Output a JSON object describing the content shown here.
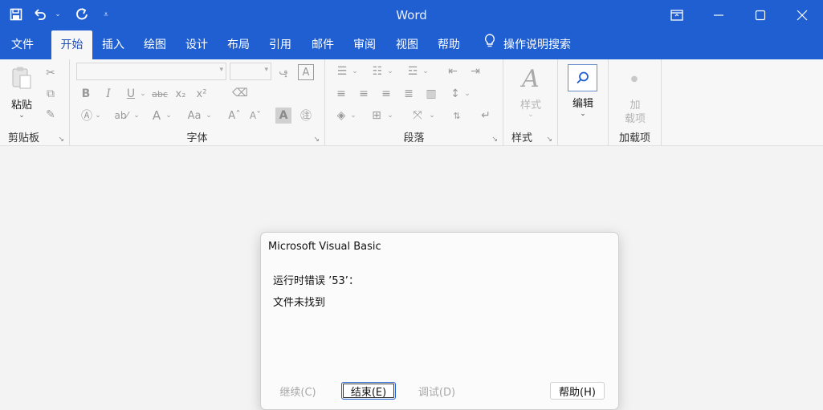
{
  "window": {
    "title": "Word"
  },
  "qat": {
    "save_icon": "save-icon",
    "undo_icon": "undo-icon",
    "redo_icon": "redo-icon",
    "customize_icon": "customize-icon"
  },
  "tabs": [
    {
      "label": "文件"
    },
    {
      "label": "开始"
    },
    {
      "label": "插入"
    },
    {
      "label": "绘图"
    },
    {
      "label": "设计"
    },
    {
      "label": "布局"
    },
    {
      "label": "引用"
    },
    {
      "label": "邮件"
    },
    {
      "label": "审阅"
    },
    {
      "label": "视图"
    },
    {
      "label": "帮助"
    }
  ],
  "tell_me": {
    "label": "操作说明搜索"
  },
  "ribbon": {
    "clipboard": {
      "label": "剪贴板",
      "paste_label": "粘贴"
    },
    "font": {
      "label": "字体",
      "font_name": "",
      "font_size": ""
    },
    "paragraph": {
      "label": "段落"
    },
    "styles": {
      "label": "样式",
      "button_label": "样式"
    },
    "editing": {
      "button_label": "编辑"
    },
    "addins": {
      "label": "加载项",
      "button_label_1": "加",
      "button_label_2": "载项"
    }
  },
  "dialog": {
    "title": "Microsoft Visual Basic",
    "message1": "运行时错误 ’53’：",
    "message2": "文件未找到",
    "buttons": {
      "continue": "继续(C)",
      "end": "结束(E)",
      "debug": "调试(D)",
      "help": "帮助(H)"
    }
  },
  "colors": {
    "accent": "#1f5fd1",
    "ribbon_bg": "#f7f7f7",
    "doc_bg": "#f3f3f3"
  }
}
